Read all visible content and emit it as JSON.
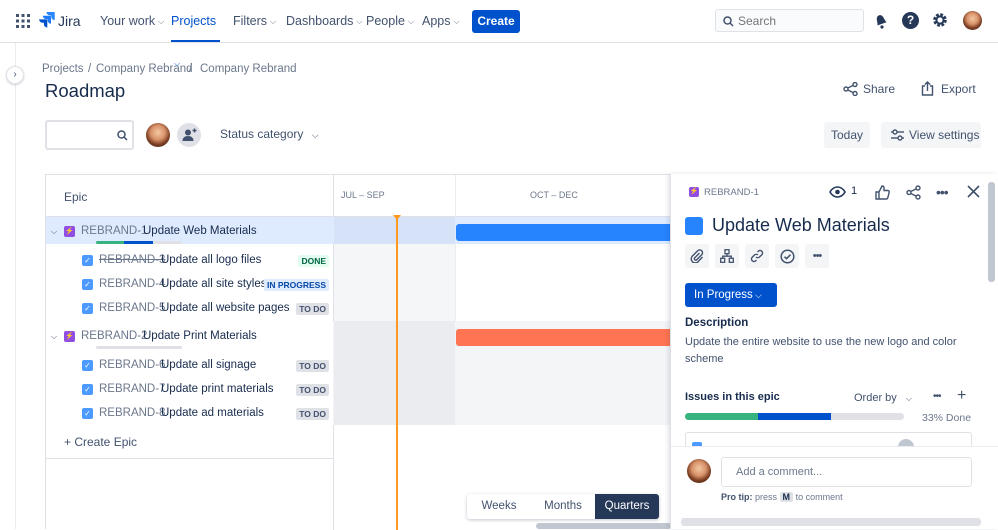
{
  "nav": {
    "logo_text": "Jira",
    "items": [
      {
        "label": "Your work",
        "active": false
      },
      {
        "label": "Projects",
        "active": true
      },
      {
        "label": "Filters",
        "active": false
      },
      {
        "label": "Dashboards",
        "active": false
      },
      {
        "label": "People",
        "active": false
      },
      {
        "label": "Apps",
        "active": false
      }
    ],
    "create_label": "Create",
    "search_placeholder": "Search"
  },
  "breadcrumb": [
    "Projects",
    "Company Rebrand",
    "Company Rebrand"
  ],
  "page_title": "Roadmap",
  "actions": {
    "share": "Share",
    "export": "Export"
  },
  "filters": {
    "status_category": "Status category",
    "today": "Today",
    "view_settings": "View settings"
  },
  "roadmap": {
    "epic_header": "Epic",
    "periods": [
      "JUL – SEP",
      "OCT – DEC"
    ],
    "epics": [
      {
        "key": "REBRAND-1",
        "summary": "Update Web Materials",
        "color": "#2684ff",
        "progress_done": 0.33,
        "progress_in_progress": 0.33,
        "children": [
          {
            "key": "REBRAND-3",
            "summary": "Update all logo files",
            "status": "DONE",
            "strike": true
          },
          {
            "key": "REBRAND-4",
            "summary": "Update all site styles",
            "status": "IN PROGRESS",
            "strike": false
          },
          {
            "key": "REBRAND-5",
            "summary": "Update all website pages",
            "status": "TO DO",
            "strike": false
          }
        ]
      },
      {
        "key": "REBRAND-2",
        "summary": "Update Print Materials",
        "color": "#ff7452",
        "progress_done": 0,
        "progress_in_progress": 0,
        "children": [
          {
            "key": "REBRAND-6",
            "summary": "Update all signage",
            "status": "TO DO",
            "strike": false
          },
          {
            "key": "REBRAND-7",
            "summary": "Update print materials",
            "status": "TO DO",
            "strike": false
          },
          {
            "key": "REBRAND-8",
            "summary": "Update ad materials",
            "status": "TO DO",
            "strike": false
          }
        ]
      }
    ],
    "create_epic_label": "+ Create Epic",
    "view_tabs": [
      {
        "label": "Weeks",
        "active": false
      },
      {
        "label": "Months",
        "active": false
      },
      {
        "label": "Quarters",
        "active": true
      }
    ]
  },
  "detail": {
    "issue_key": "REBRAND-1",
    "watch_count": "1",
    "title": "Update Web Materials",
    "status": "In Progress",
    "description_heading": "Description",
    "description": "Update the entire website to use the new logo and color scheme",
    "issues_heading": "Issues in this epic",
    "order_by": "Order by",
    "percent_done": "33% Done",
    "comment_placeholder": "Add a comment...",
    "pro_tip_label": "Pro tip:",
    "pro_tip_press": "press",
    "pro_tip_key": "M",
    "pro_tip_rest": "to comment"
  },
  "colors": {
    "brand": "#0052cc",
    "epic_bar_1": "#2684ff",
    "epic_bar_2": "#ff7452",
    "today_line": "#ff991f",
    "done_green": "#36b37e"
  }
}
